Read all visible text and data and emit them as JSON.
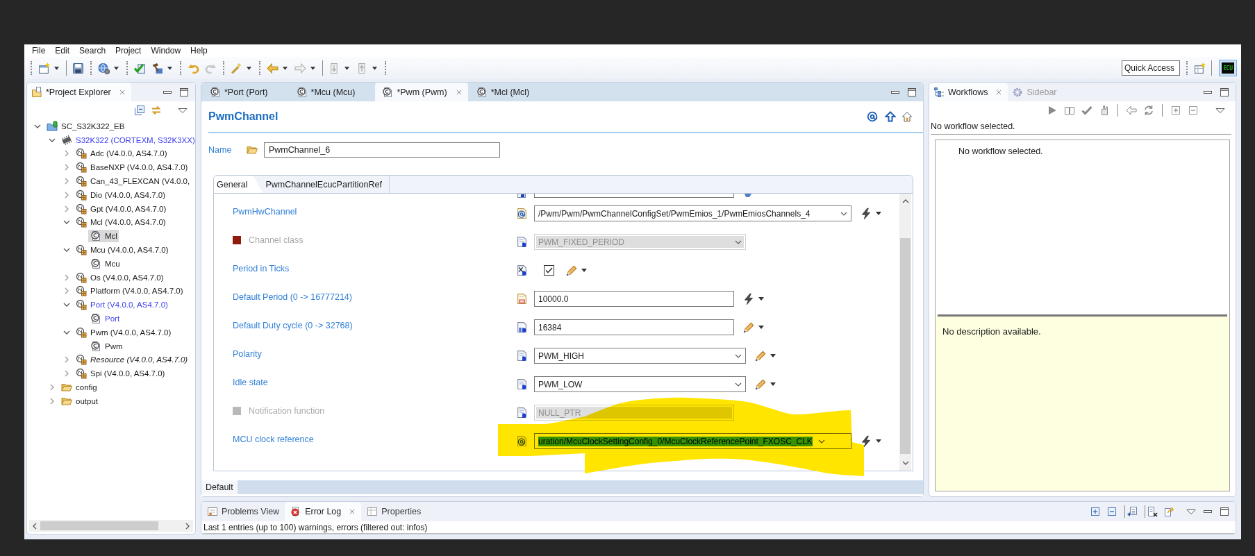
{
  "menu": [
    "File",
    "Edit",
    "Search",
    "Project",
    "Window",
    "Help"
  ],
  "toolbar": {
    "quick_access": {
      "placeholder": "Quick Access"
    },
    "perspective": {
      "label": "ECU",
      "selected": true
    }
  },
  "project_explorer": {
    "title": "*Project Explorer",
    "tree": [
      {
        "label": "SC_S32K322_EB",
        "kind": "project",
        "expanded": true,
        "selected": false,
        "highlighted": false,
        "italic": false,
        "children": [
          {
            "label": "S32K322 (CORTEXM, S32K3XX)",
            "kind": "ecu",
            "expanded": true,
            "selected": false,
            "highlighted": true,
            "italic": false,
            "children": [
              {
                "label": "Adc (V4.0.0, AS4.7.0)",
                "kind": "module",
                "expanded": false,
                "selected": false,
                "highlighted": false,
                "italic": false
              },
              {
                "label": "BaseNXP (V4.0.0, AS4.7.0)",
                "kind": "module",
                "expanded": false,
                "selected": false,
                "highlighted": false,
                "italic": false
              },
              {
                "label": "Can_43_FLEXCAN (V4.0.0,",
                "kind": "module",
                "expanded": false,
                "selected": false,
                "highlighted": false,
                "italic": false
              },
              {
                "label": "Dio (V4.0.0, AS4.7.0)",
                "kind": "module",
                "expanded": false,
                "selected": false,
                "highlighted": false,
                "italic": false
              },
              {
                "label": "Gpt (V4.0.0, AS4.7.0)",
                "kind": "module",
                "expanded": false,
                "selected": false,
                "highlighted": false,
                "italic": false
              },
              {
                "label": "Mcl (V4.0.0, AS4.7.0)",
                "kind": "module",
                "expanded": true,
                "selected": false,
                "highlighted": false,
                "italic": false,
                "children": [
                  {
                    "label": "Mcl",
                    "kind": "config",
                    "selected": true,
                    "highlighted": false,
                    "italic": false
                  }
                ]
              },
              {
                "label": "Mcu (V4.0.0, AS4.7.0)",
                "kind": "module",
                "expanded": true,
                "selected": false,
                "highlighted": false,
                "italic": false,
                "children": [
                  {
                    "label": "Mcu",
                    "kind": "config",
                    "selected": false,
                    "highlighted": false,
                    "italic": false
                  }
                ]
              },
              {
                "label": "Os (V4.0.0, AS4.7.0)",
                "kind": "module",
                "expanded": false,
                "selected": false,
                "highlighted": false,
                "italic": false
              },
              {
                "label": "Platform (V4.0.0, AS4.7.0)",
                "kind": "module",
                "expanded": false,
                "selected": false,
                "highlighted": false,
                "italic": false
              },
              {
                "label": "Port (V4.0.0, AS4.7.0)",
                "kind": "module",
                "expanded": true,
                "selected": false,
                "highlighted": true,
                "italic": false,
                "children": [
                  {
                    "label": "Port",
                    "kind": "config",
                    "selected": false,
                    "highlighted": true,
                    "italic": false
                  }
                ]
              },
              {
                "label": "Pwm (V4.0.0, AS4.7.0)",
                "kind": "module",
                "expanded": true,
                "selected": false,
                "highlighted": false,
                "italic": false,
                "children": [
                  {
                    "label": "Pwm",
                    "kind": "config",
                    "selected": false,
                    "highlighted": false,
                    "italic": false
                  }
                ]
              },
              {
                "label": "Resource (V4.0.0, AS4.7.0)",
                "kind": "module",
                "expanded": false,
                "selected": false,
                "highlighted": false,
                "italic": true
              },
              {
                "label": "Spi (V4.0.0, AS4.7.0)",
                "kind": "module",
                "expanded": false,
                "selected": false,
                "highlighted": false,
                "italic": false
              }
            ]
          },
          {
            "label": "config",
            "kind": "folder",
            "expanded": false,
            "selected": false,
            "highlighted": false,
            "italic": false
          },
          {
            "label": "output",
            "kind": "folder",
            "expanded": false,
            "selected": false,
            "highlighted": false,
            "italic": false
          }
        ]
      }
    ]
  },
  "editor": {
    "tabs": [
      {
        "label": "*Port (Port)",
        "selected": false
      },
      {
        "label": "*Mcu (Mcu)",
        "selected": false
      },
      {
        "label": "*Pwm (Pwm)",
        "selected": true
      },
      {
        "label": "*Mcl (Mcl)",
        "selected": false
      }
    ],
    "heading": "PwmChannel",
    "name": {
      "label": "Name",
      "value": "PwmChannel_6"
    },
    "inner_tabs": [
      {
        "label": "General",
        "selected": true
      },
      {
        "label": "PwmChannelEcucPartitionRef",
        "selected": false
      }
    ],
    "rows": [
      {
        "kind": "reference",
        "label": "PwmHwChannel",
        "value": "/Pwm/Pwm/PwmChannelConfigSet/PwmEmios_1/PwmEmiosChannels_4",
        "disabled": false,
        "text_selected": false,
        "marked": false
      },
      {
        "kind": "enum",
        "label": "Channel class",
        "value": "PWM_FIXED_PERIOD",
        "disabled": true,
        "color": "#8e1b0e",
        "text_selected": false,
        "marked": false
      },
      {
        "kind": "boolean",
        "label": "Period in Ticks",
        "checked": true,
        "disabled": false,
        "marked": false
      },
      {
        "kind": "float",
        "label": "Default Period (0 -> 16777214)",
        "value": "10000.0",
        "disabled": false,
        "text_selected": false,
        "marked": false
      },
      {
        "kind": "integer",
        "label": "Default Duty cycle (0 -> 32768)",
        "value": "16384",
        "disabled": false,
        "text_selected": false,
        "marked": false
      },
      {
        "kind": "enum",
        "label": "Polarity",
        "value": "PWM_HIGH",
        "disabled": false,
        "text_selected": false,
        "marked": false
      },
      {
        "kind": "enum",
        "label": "Idle state",
        "value": "PWM_LOW",
        "disabled": false,
        "text_selected": false,
        "marked": false
      },
      {
        "kind": "function",
        "label": "Notification function",
        "value": "NULL_PTR",
        "disabled": true,
        "color": "#b9b9b9",
        "text_selected": false,
        "marked": false
      },
      {
        "kind": "reference",
        "label": "MCU clock reference",
        "value": "uration/McuClockSettingConfig_0/McuClockReferencePoint_FXOSC_CLK",
        "disabled": false,
        "text_selected": true,
        "marked": true
      }
    ],
    "bottom_tabs": [
      {
        "label": "Default",
        "selected": true
      }
    ]
  },
  "workflows": {
    "tabs": [
      {
        "label": "Workflows",
        "selected": true
      },
      {
        "label": "Sidebar",
        "selected": false
      }
    ],
    "status": "No workflow selected.",
    "list_message": "No workflow selected.",
    "description": "No description available."
  },
  "bottom_panel": {
    "tabs": [
      {
        "label": "Problems View",
        "kind": "problems",
        "selected": false
      },
      {
        "label": "Error Log",
        "kind": "errors",
        "selected": true
      },
      {
        "label": "Properties",
        "kind": "properties",
        "selected": false
      }
    ],
    "status": "Last 1 entries (up to 100) warnings, errors (filtered out: infos)"
  }
}
